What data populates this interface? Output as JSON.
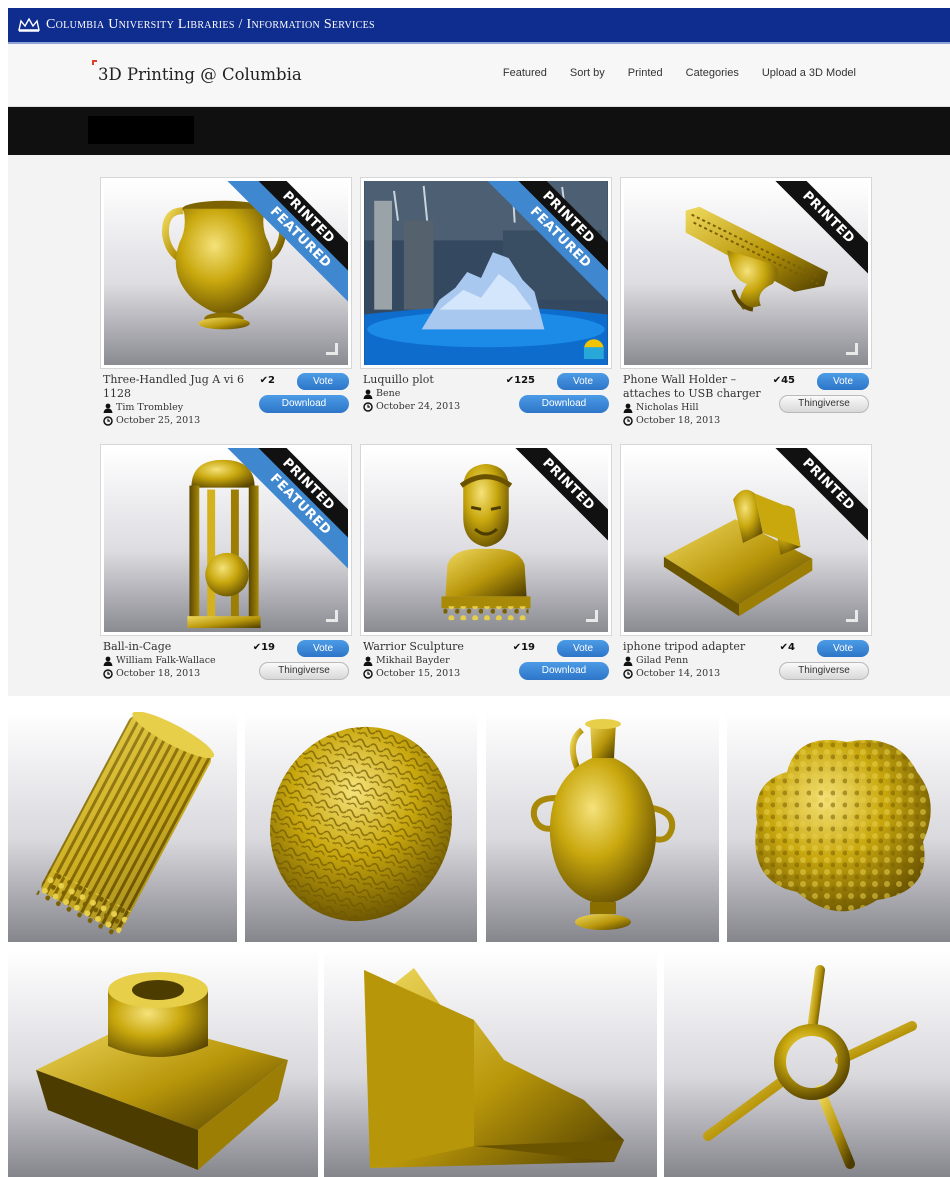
{
  "banner": {
    "title": "Columbia University Libraries / Information Services"
  },
  "site": {
    "logo": "3D Printing @ Columbia"
  },
  "nav": [
    "Featured",
    "Sort by",
    "Printed",
    "Categories",
    "Upload a 3D Model"
  ],
  "ribbons": {
    "printed": "PRINTED",
    "featured": "FEATURED"
  },
  "vote_label": "Vote",
  "cards": [
    {
      "title": "Three-Handled Jug A vi 6 1128",
      "author": "Tim Trombley",
      "date": "October 25, 2013",
      "votes": "2",
      "action": "Download",
      "printed": true,
      "featured": true,
      "model": "three-handled-jug"
    },
    {
      "title": "Luquillo plot",
      "author": "Bene",
      "date": "October 24, 2013",
      "votes": "125",
      "action": "Download",
      "printed": true,
      "featured": true,
      "model": "luquillo-plot-photo"
    },
    {
      "title": "Phone Wall Holder – attaches to USB charger",
      "author": "Nicholas Hill",
      "date": "October 18, 2013",
      "votes": "45",
      "action": "Thingiverse",
      "printed": true,
      "featured": false,
      "model": "phone-wall-holder"
    },
    {
      "title": "Ball-in-Cage",
      "author": "William Falk-Wallace",
      "date": "October 18, 2013",
      "votes": "19",
      "action": "Thingiverse",
      "printed": true,
      "featured": true,
      "model": "ball-in-cage"
    },
    {
      "title": "Warrior Sculpture",
      "author": "Mikhail Bayder",
      "date": "October 15, 2013",
      "votes": "19",
      "action": "Download",
      "printed": true,
      "featured": false,
      "model": "warrior-bust"
    },
    {
      "title": "iphone tripod adapter",
      "author": "Gilad Penn",
      "date": "October 14, 2013",
      "votes": "4",
      "action": "Thingiverse",
      "printed": true,
      "featured": false,
      "model": "tripod-adapter"
    }
  ],
  "gallery": [
    "ribbed-cylinder",
    "brain",
    "amphora",
    "protein-surface",
    "block-with-cup",
    "terrain-wedge",
    "ring-with-spokes"
  ],
  "colors": {
    "banner": "#0f2d8f",
    "vote_button": "#3a86d6",
    "featured_ribbon": "#3f88d0",
    "printed_ribbon": "#111111",
    "model_gold": "#c9a80e"
  }
}
